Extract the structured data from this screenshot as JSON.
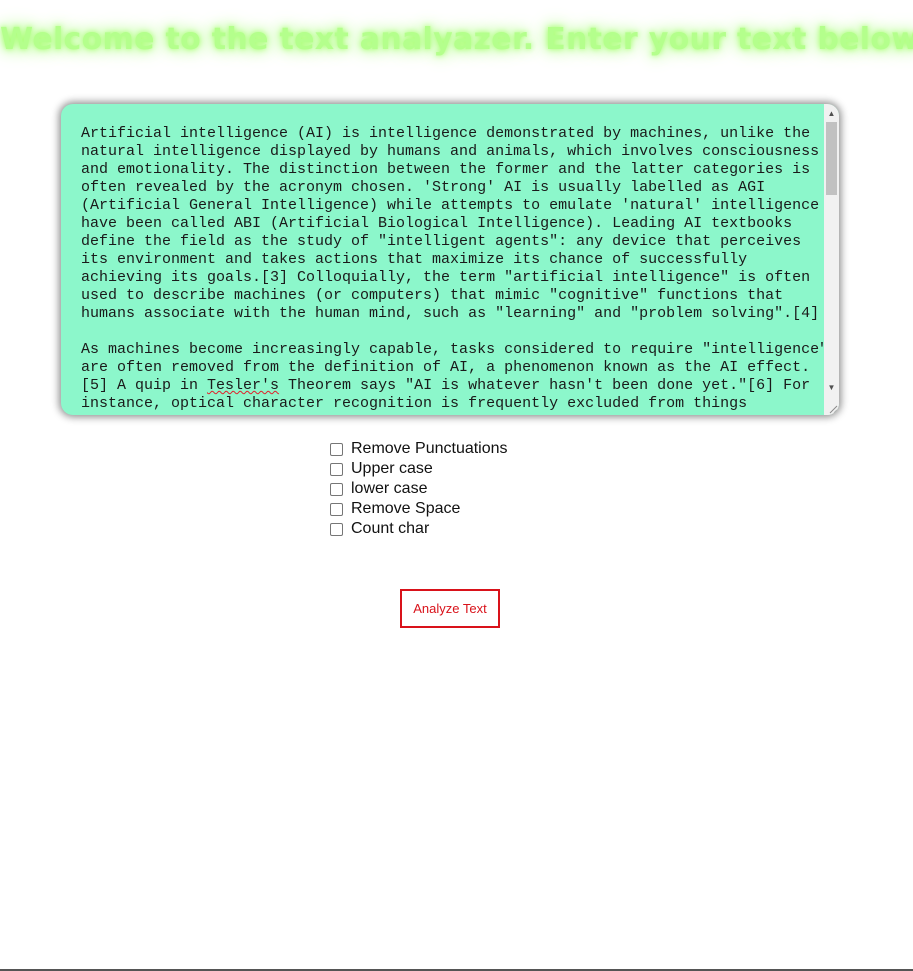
{
  "header": {
    "title": "Welcome to the text analyazer. Enter your text below"
  },
  "editor": {
    "lines": [
      "Artificial intelligence (AI) is intelligence demonstrated by machines, unlike the",
      "natural intelligence displayed by humans and animals, which involves consciousness",
      "and emotionality. The distinction between the former and the latter categories is",
      "often revealed by the acronym chosen. 'Strong' AI is usually labelled as AGI",
      "(Artificial General Intelligence) while attempts to emulate 'natural' intelligence",
      "have been called ABI (Artificial Biological Intelligence). Leading AI textbooks",
      "define the field as the study of \"intelligent agents\": any device that perceives",
      "its environment and takes actions that maximize its chance of successfully",
      "achieving its goals.[3] Colloquially, the term \"artificial intelligence\" is often",
      "used to describe machines (or computers) that mimic \"cognitive\" functions that",
      "humans associate with the human mind, such as \"learning\" and \"problem solving\".[4]",
      "",
      "As machines become increasingly capable, tasks considered to require \"intelligence\"",
      "are often removed from the definition of AI, a phenomenon known as the AI effect.",
      "[5] A quip in ",
      "instance, optical character recognition is frequently excluded from things"
    ],
    "line14_word": "Tesler's",
    "line14_rest": " Theorem says \"AI is whatever hasn't been done yet.\"[6] For",
    "background_color": "#8cf7cb"
  },
  "options": [
    {
      "label": "Remove Punctuations",
      "checked": false
    },
    {
      "label": "Upper case",
      "checked": false
    },
    {
      "label": "lower case",
      "checked": false
    },
    {
      "label": "Remove Space",
      "checked": false
    },
    {
      "label": "Count char",
      "checked": false
    }
  ],
  "actions": {
    "analyze_label": "Analyze Text"
  },
  "colors": {
    "title_glow": "#b4ff8c",
    "button_accent": "#d9121a"
  },
  "icons": {
    "scroll_up": "triangle-up-icon",
    "scroll_down": "triangle-down-icon",
    "resize": "resize-grip-icon"
  }
}
